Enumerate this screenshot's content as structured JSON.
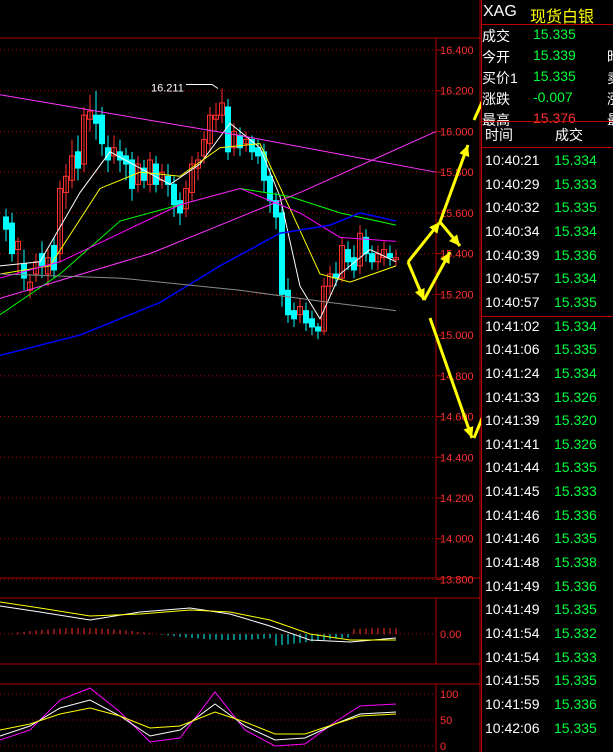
{
  "symbol": "XAG",
  "symbol_name": "现货白银",
  "quote": [
    {
      "label": "成交",
      "value": "15.335",
      "color": "#00ff3c",
      "ext": ""
    },
    {
      "label": "今开",
      "value": "15.339",
      "color": "#00ff3c",
      "ext": "昨"
    },
    {
      "label": "买价1",
      "value": "15.335",
      "color": "#00ff3c",
      "ext": "卖"
    },
    {
      "label": "涨跌",
      "value": "-0.007",
      "color": "#00ff3c",
      "ext": "涨"
    },
    {
      "label": "最高",
      "value": "15.376",
      "color": "#ff3030",
      "ext": "最"
    }
  ],
  "ticks_header": {
    "time": "时间",
    "price": "成交"
  },
  "ticks": [
    {
      "time": "10:40:21",
      "price": "15.334"
    },
    {
      "time": "10:40:29",
      "price": "15.333"
    },
    {
      "time": "10:40:32",
      "price": "15.335"
    },
    {
      "time": "10:40:34",
      "price": "15.334"
    },
    {
      "time": "10:40:39",
      "price": "15.336"
    },
    {
      "time": "10:40:57",
      "price": "15.334"
    },
    {
      "time": "10:40:57",
      "price": "15.335"
    },
    {
      "time": "10:41:02",
      "price": "15.334"
    },
    {
      "time": "10:41:06",
      "price": "15.335"
    },
    {
      "time": "10:41:24",
      "price": "15.334"
    },
    {
      "time": "10:41:33",
      "price": "15.326"
    },
    {
      "time": "10:41:39",
      "price": "15.320"
    },
    {
      "time": "10:41:41",
      "price": "15.326"
    },
    {
      "time": "10:41:44",
      "price": "15.335"
    },
    {
      "time": "10:41:45",
      "price": "15.333"
    },
    {
      "time": "10:41:46",
      "price": "15.336"
    },
    {
      "time": "10:41:46",
      "price": "15.335"
    },
    {
      "time": "10:41:48",
      "price": "15.338"
    },
    {
      "time": "10:41:49",
      "price": "15.336"
    },
    {
      "time": "10:41:49",
      "price": "15.335"
    },
    {
      "time": "10:41:54",
      "price": "15.332"
    },
    {
      "time": "10:41:54",
      "price": "15.333"
    },
    {
      "time": "10:41:55",
      "price": "15.335"
    },
    {
      "time": "10:41:59",
      "price": "15.336"
    },
    {
      "time": "10:42:06",
      "price": "15.335"
    }
  ],
  "price_axis_labels": [
    "16.400",
    "16.200",
    "16.000",
    "15.800",
    "15.600",
    "15.400",
    "15.200",
    "15.000",
    "14.800",
    "14.600",
    "14.400",
    "14.200",
    "14.000",
    "13.800"
  ],
  "high_annotation": "16.211",
  "macd_label": "0.00",
  "kdj_labels": [
    "100",
    "50",
    "0"
  ],
  "colors": {
    "up": "#ff3030",
    "down": "#00ffff",
    "grid": "#b00000",
    "arrow": "#ffff00"
  }
}
